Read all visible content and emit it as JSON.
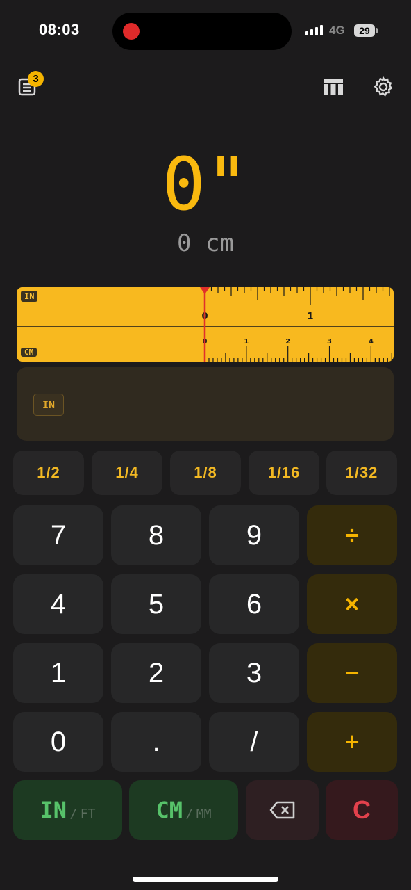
{
  "status_bar": {
    "time": "08:03",
    "network": "4G",
    "battery": "29"
  },
  "header": {
    "history_badge": "3",
    "history_icon": "list-icon",
    "table_icon": "table-icon",
    "settings_icon": "gear-icon"
  },
  "display": {
    "main_value": "0\"",
    "sub_value": "0 cm"
  },
  "ruler": {
    "top_unit": "IN",
    "bottom_unit": "CM",
    "top_labels": [
      "0",
      "1"
    ],
    "bottom_labels": [
      "0",
      "1",
      "2",
      "3",
      "4"
    ]
  },
  "input": {
    "unit_chip": "IN"
  },
  "fractions": [
    "1/2",
    "1/4",
    "1/8",
    "1/16",
    "1/32"
  ],
  "keypad": {
    "rows": [
      [
        "7",
        "8",
        "9",
        "÷"
      ],
      [
        "4",
        "5",
        "6",
        "×"
      ],
      [
        "1",
        "2",
        "3",
        "−"
      ],
      [
        "0",
        ".",
        "/",
        "+"
      ]
    ]
  },
  "bottom_row": {
    "in_main": "IN",
    "in_sub": "FT",
    "separator": "/",
    "cm_main": "CM",
    "cm_sub": "MM",
    "clear": "C"
  },
  "colors": {
    "accent": "#f9b90f",
    "background": "#1c1b1c",
    "unit_green": "#57c26a",
    "clear_red": "#e2414c"
  }
}
